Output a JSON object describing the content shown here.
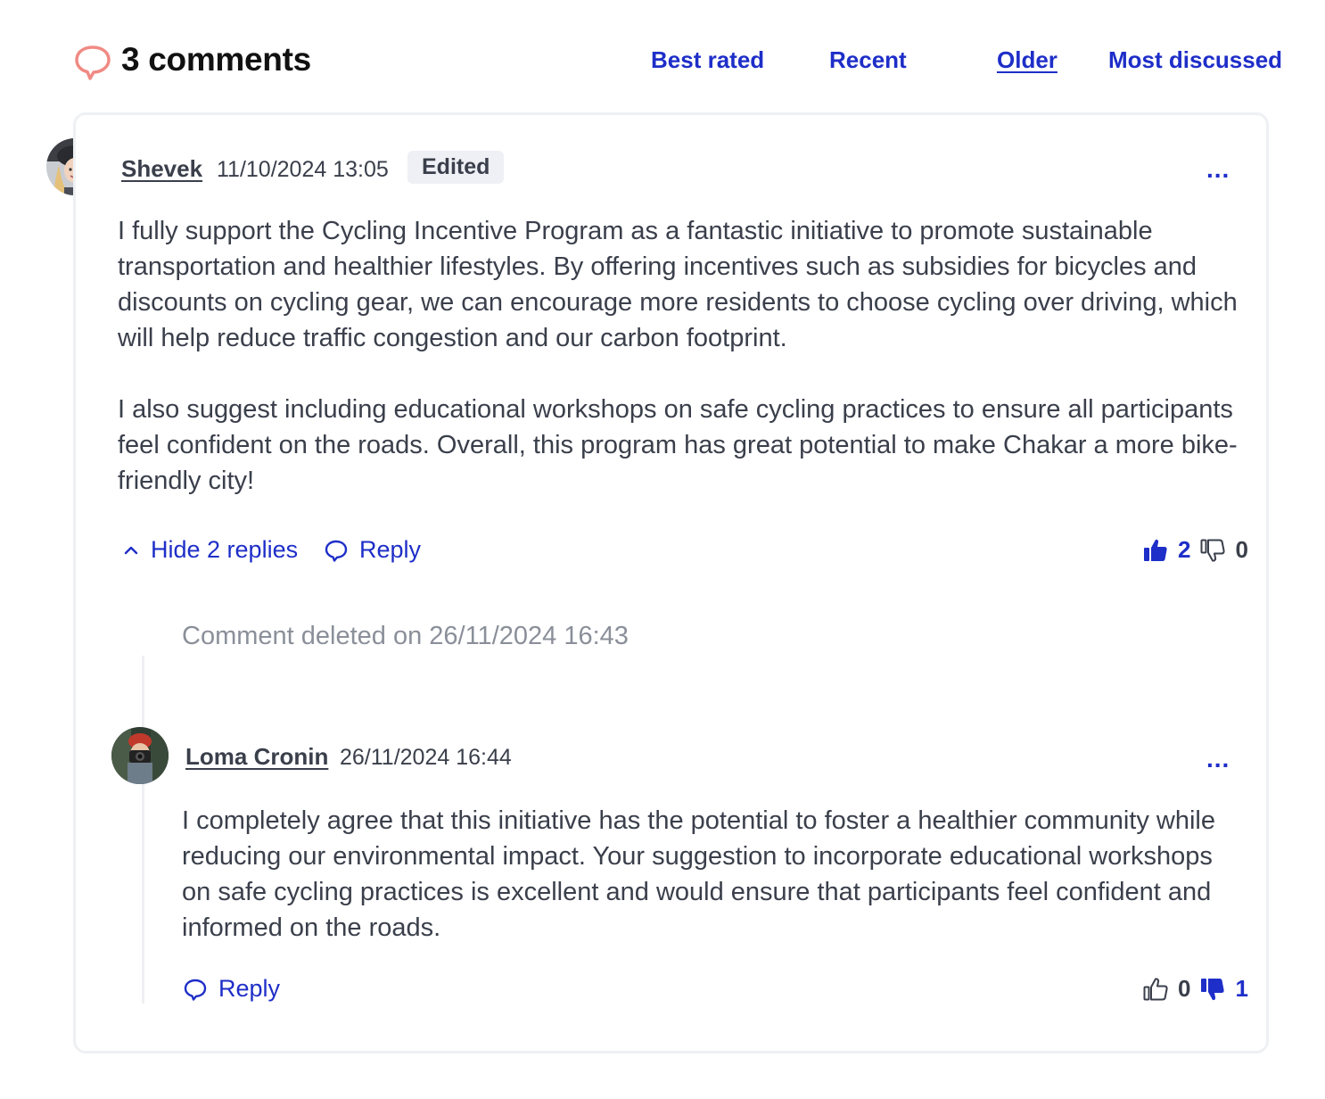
{
  "header": {
    "count_label": "3 comments",
    "sort_options": [
      {
        "label": "Best rated",
        "active": false
      },
      {
        "label": "Recent",
        "active": false
      },
      {
        "label": "Older",
        "active": true
      },
      {
        "label": "Most discussed",
        "active": false
      }
    ]
  },
  "comments": [
    {
      "author": "Shevek",
      "date": "11/10/2024 13:05",
      "badge": "Edited",
      "more": "...",
      "paragraphs": [
        "I fully support the Cycling Incentive Program as a fantastic initiative to promote sustainable transportation and healthier lifestyles. By offering incentives such as subsidies for bicycles and discounts on cycling gear, we can encourage more residents to choose cycling over driving, which will help reduce traffic congestion and our carbon footprint.",
        "I also suggest including educational workshops on safe cycling practices to ensure all participants feel confident on the roads. Overall, this program has great potential to make Chakar a more bike-friendly city!"
      ],
      "hide_replies": "Hide 2 replies",
      "reply": "Reply",
      "upvotes": "2",
      "downvotes": "0",
      "upvoted": true,
      "downvoted": false,
      "replies": [
        {
          "deleted_text": "Comment deleted on 26/11/2024 16:43"
        },
        {
          "author": "Loma Cronin",
          "date": "26/11/2024 16:44",
          "more": "...",
          "text": "I completely agree that this initiative has the potential to foster a healthier community while reducing our environmental impact. Your suggestion to incorporate educational workshops on safe cycling practices is excellent and would ensure that participants feel confident and informed on the roads.",
          "reply": "Reply",
          "upvotes": "0",
          "downvotes": "1",
          "upvoted": false,
          "downvoted": true
        }
      ]
    }
  ],
  "colors": {
    "accent": "#1e2ec8",
    "text": "#3a3f4b",
    "muted": "#8a8f99",
    "comment_icon": "#f08a84",
    "border": "#eef0f3"
  },
  "icons": {
    "header": "speech-bubble-icon",
    "hide": "chevron-up-icon",
    "reply": "speech-bubble-icon",
    "up": "thumbs-up-icon",
    "down": "thumbs-down-icon"
  }
}
